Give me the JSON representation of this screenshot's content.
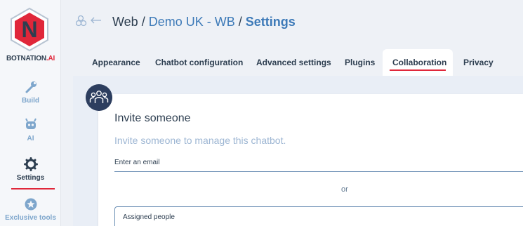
{
  "brand": {
    "part1": "BOTNATION",
    "part2": ".AI",
    "logo_letter": "N",
    "icon": "botnation-logo-icon"
  },
  "sidebar": {
    "items": [
      {
        "label": "Build",
        "icon": "wrench-icon"
      },
      {
        "label": "AI",
        "icon": "robot-icon"
      },
      {
        "label": "Settings",
        "icon": "gear-icon",
        "active": true
      },
      {
        "label": "Exclusive tools",
        "icon": "star-icon"
      }
    ]
  },
  "header": {
    "back_icon": "back-arrow-icon",
    "crumb_root": "Web",
    "separator": "/",
    "crumb_bot": "Demo UK - WB",
    "crumb_current": "Settings"
  },
  "tabs": [
    {
      "label": "Appearance"
    },
    {
      "label": "Chatbot configuration"
    },
    {
      "label": "Advanced settings"
    },
    {
      "label": "Plugins"
    },
    {
      "label": "Collaboration",
      "active": true
    },
    {
      "label": "Privacy"
    }
  ],
  "collaboration": {
    "icon": "team-icon",
    "title": "Invite someone",
    "subtitle": "Invite someone to manage this chatbot.",
    "email_placeholder": "Enter an email",
    "or": "or",
    "assigned_label": "Assigned people"
  },
  "colors": {
    "accent_red": "#e0273a",
    "navy": "#2d3e50",
    "link_blue": "#3d7ab8",
    "muted_blue": "#7ea6cc"
  }
}
